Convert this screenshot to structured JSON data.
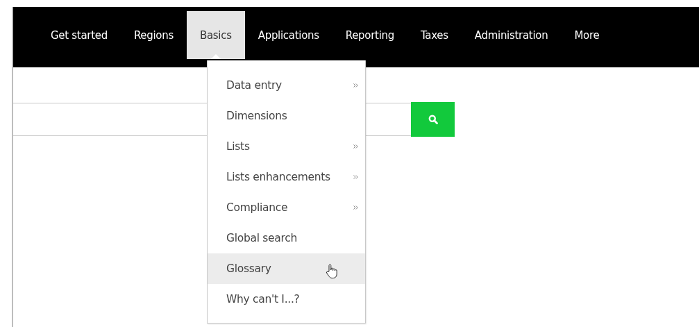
{
  "nav": {
    "items": [
      {
        "label": "Get started",
        "selected": false
      },
      {
        "label": "Regions",
        "selected": false
      },
      {
        "label": "Basics",
        "selected": true
      },
      {
        "label": "Applications",
        "selected": false
      },
      {
        "label": "Reporting",
        "selected": false
      },
      {
        "label": "Taxes",
        "selected": false
      },
      {
        "label": "Administration",
        "selected": false
      },
      {
        "label": "More",
        "selected": false
      }
    ]
  },
  "menu": {
    "items": [
      {
        "label": "Data entry",
        "submenu": true,
        "hovered": false
      },
      {
        "label": "Dimensions",
        "submenu": false,
        "hovered": false
      },
      {
        "label": "Lists",
        "submenu": true,
        "hovered": false
      },
      {
        "label": "Lists enhancements",
        "submenu": true,
        "hovered": false
      },
      {
        "label": "Compliance",
        "submenu": true,
        "hovered": false
      },
      {
        "label": "Global search",
        "submenu": false,
        "hovered": false
      },
      {
        "label": "Glossary",
        "submenu": false,
        "hovered": true
      },
      {
        "label": "Why can't I...?",
        "submenu": false,
        "hovered": false
      }
    ]
  }
}
